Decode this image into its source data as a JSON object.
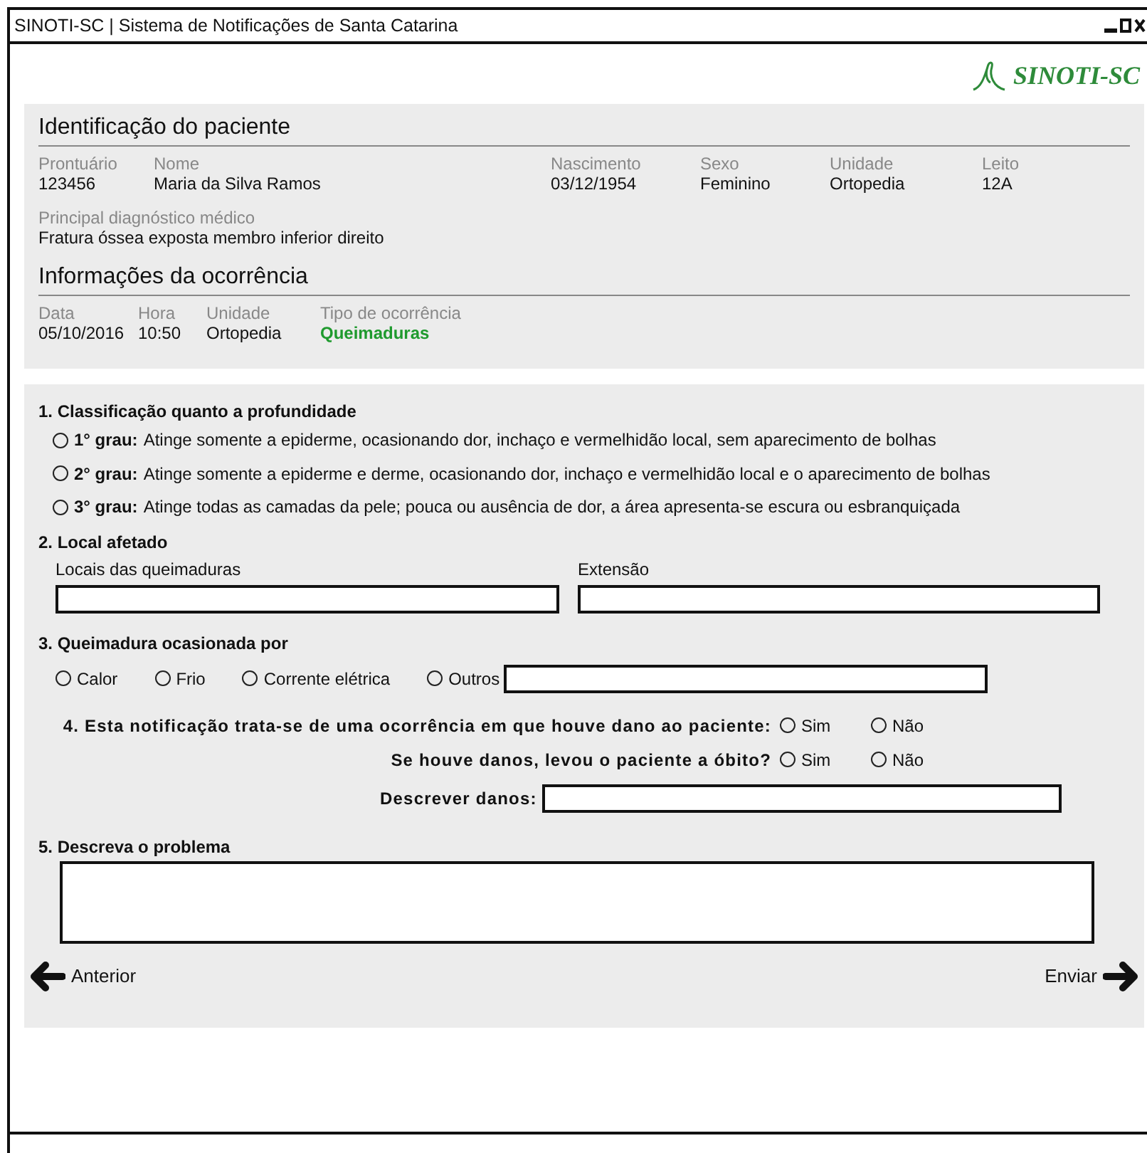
{
  "window": {
    "title": "SINOTI-SC | Sistema de Notificações de Santa Catarina"
  },
  "logo": {
    "text": "SINOTI-SC"
  },
  "patient": {
    "heading": "Identificação do paciente",
    "fields": [
      {
        "label": "Prontuário",
        "value": "123456"
      },
      {
        "label": "Nome",
        "value": "Maria da Silva Ramos"
      },
      {
        "label": "Nascimento",
        "value": "03/12/1954"
      },
      {
        "label": "Sexo",
        "value": "Feminino"
      },
      {
        "label": "Unidade",
        "value": "Ortopedia"
      },
      {
        "label": "Leito",
        "value": "12A"
      }
    ],
    "diagnosis": {
      "label": "Principal diagnóstico médico",
      "value": "Fratura óssea exposta membro inferior direito"
    }
  },
  "occurrence": {
    "heading": "Informações da ocorrência",
    "fields": [
      {
        "label": "Data",
        "value": "05/10/2016",
        "highlight": false
      },
      {
        "label": "Hora",
        "value": "10:50",
        "highlight": false
      },
      {
        "label": "Unidade",
        "value": "Ortopedia",
        "highlight": false
      },
      {
        "label": "Tipo de ocorrência",
        "value": "Queimaduras",
        "highlight": true
      }
    ]
  },
  "q1": {
    "title": "1. Classificação quanto a profundidade",
    "options": [
      {
        "label": "**1° grau:** Atinge somente a epiderme, ocasionando dor, inchaço e vermelhidão local, sem aparecimento de bolhas",
        "selected": false
      },
      {
        "label": "**2° grau:** Atinge somente a epiderme e derme, ocasionando dor, inchaço e vermelhidão local e o aparecimento de bolhas",
        "selected": false
      },
      {
        "label": "**3° grau:** Atinge todas as camadas da pele; pouca ou ausência de dor, a área apresenta-se escura ou esbranquiçada",
        "selected": false
      }
    ]
  },
  "q2": {
    "title": "2. Local afetado",
    "fields": [
      {
        "label": "Locais das queimaduras"
      },
      {
        "label": "Extensão"
      }
    ]
  },
  "q3": {
    "title": "3. Queimadura ocasionada por",
    "options": [
      {
        "label": "Calor",
        "selected": false,
        "with_field": false
      },
      {
        "label": "Frio",
        "selected": false,
        "with_field": false
      },
      {
        "label": "Corrente elétrica",
        "selected": false,
        "with_field": false
      },
      {
        "label": "Outros",
        "selected": false,
        "with_field": true
      }
    ]
  },
  "q4": {
    "questions": [
      {
        "text": "4. Esta notificação trata-se de uma ocorrência em que houve dano ao paciente:",
        "options": [
          {
            "label": "Sim",
            "selected": false
          },
          {
            "label": "Não",
            "selected": false
          }
        ]
      },
      {
        "text": "Se houve danos, levou o paciente a óbito?",
        "options": [
          {
            "label": "Sim",
            "selected": false
          },
          {
            "label": "Não",
            "selected": false
          }
        ]
      }
    ],
    "describe_label": "Descrever danos:"
  },
  "q5": {
    "title": "5. Descreva o problema"
  },
  "nav": {
    "previous": "Anterior",
    "next": "Enviar"
  }
}
